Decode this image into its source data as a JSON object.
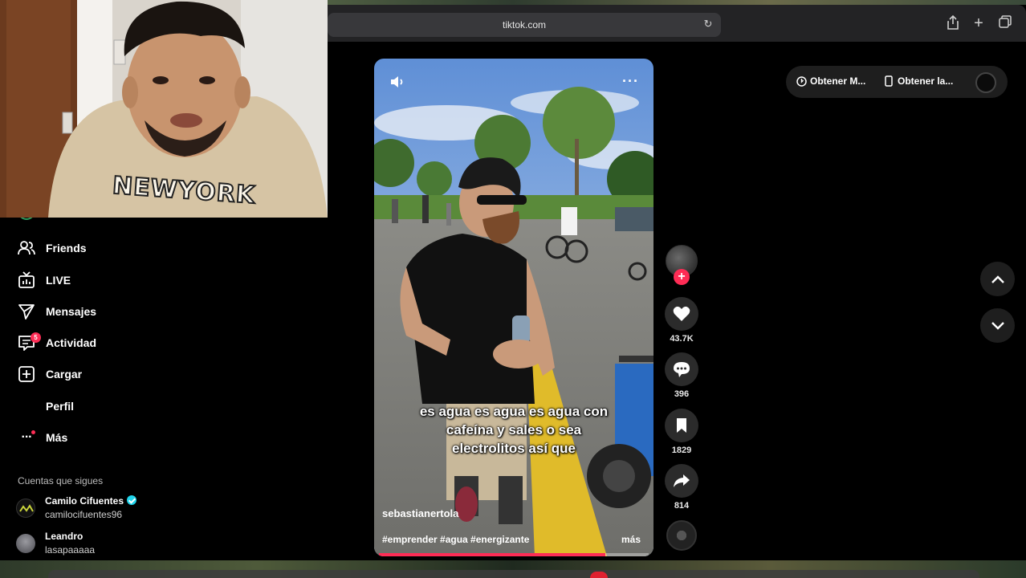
{
  "browser": {
    "url": "tiktok.com"
  },
  "sidebar": {
    "items": [
      {
        "label": "Friends",
        "icon": "friends-icon"
      },
      {
        "label": "LIVE",
        "icon": "live-icon"
      },
      {
        "label": "Mensajes",
        "icon": "messages-icon"
      },
      {
        "label": "Actividad",
        "icon": "activity-icon",
        "badge": "5"
      },
      {
        "label": "Cargar",
        "icon": "upload-icon"
      },
      {
        "label": "Perfil",
        "icon": "profile-icon"
      },
      {
        "label": "Más",
        "icon": "more-icon"
      }
    ],
    "following_title": "Cuentas que sigues",
    "accounts": [
      {
        "name": "Camilo Cifuentes",
        "handle": "camilocifuentes96",
        "verified": true
      },
      {
        "name": "Leandro",
        "handle": "lasapaaaaa",
        "verified": false
      }
    ]
  },
  "webcam": {
    "shirt_text": "NEWYORK"
  },
  "video": {
    "caption_lines": [
      "es agua es agua es agua con",
      "cafeína y sales o sea",
      "electrolitos así que"
    ],
    "author": "sebastianertola",
    "hashtags": "#emprender #agua #energizante",
    "more_label": "más",
    "progress": 0.84
  },
  "actions": {
    "likes": "43.7K",
    "comments": "396",
    "saves": "1829",
    "shares": "814"
  },
  "top_pill": {
    "item1": "Obtener M...",
    "item2": "Obtener la..."
  },
  "colors": {
    "accent": "#fe2c55",
    "verified": "#20d5ec"
  }
}
